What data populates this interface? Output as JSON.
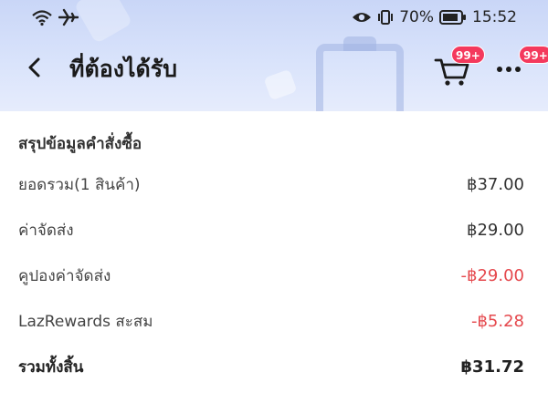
{
  "status_bar": {
    "battery_percent": "70%",
    "time": "15:52",
    "icons": [
      "wifi-icon",
      "airplane-icon",
      "eye-icon",
      "vibrate-icon",
      "battery-icon"
    ]
  },
  "header": {
    "title": "ที่ต้องได้รับ",
    "cart_badge": "99+",
    "more_badge": "99+"
  },
  "summary": {
    "title": "สรุปข้อมูลคำสั่งซื้อ",
    "rows": [
      {
        "label": "ยอดรวม(1 สินค้า)",
        "value": "฿37.00"
      },
      {
        "label": "ค่าจัดส่ง",
        "value": "฿29.00"
      },
      {
        "label": "คูปองค่าจัดส่ง",
        "value": "-฿29.00"
      },
      {
        "label": "LazRewards สะสม",
        "value": "-฿5.28"
      }
    ],
    "total": {
      "label": "รวมทั้งสิ้น",
      "value": "฿31.72"
    }
  },
  "colors": {
    "header_top": "#c9d6f7",
    "badge": "#f4395d",
    "negative": "#e5484d"
  }
}
